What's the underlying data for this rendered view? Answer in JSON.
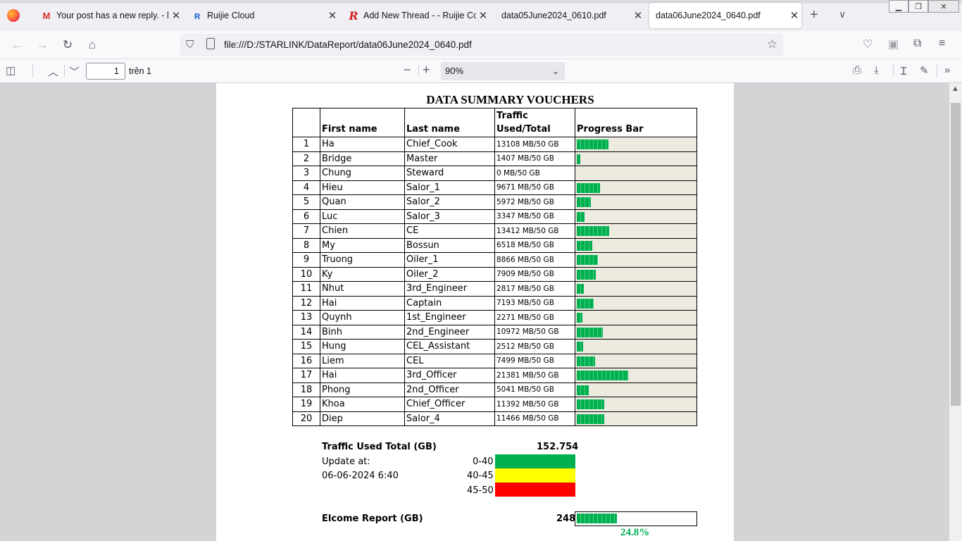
{
  "browser": {
    "tabs": [
      {
        "label": "Your post has a new reply. - lie",
        "icon": "gmail-icon"
      },
      {
        "label": "Ruijie Cloud",
        "icon": "ruijie-icon"
      },
      {
        "label": "Add New Thread - - Ruijie Com",
        "icon": "ruijie-community-icon"
      },
      {
        "label": "data05June2024_0610.pdf",
        "icon": ""
      },
      {
        "label": "data06June2024_0640.pdf",
        "icon": "",
        "active": true
      }
    ],
    "url": "file:///D:/STARLINK/DataReport/data06June2024_0640.pdf"
  },
  "pdf_toolbar": {
    "page_number": "1",
    "page_total": "trên 1",
    "zoom": "90%"
  },
  "report": {
    "title": "DATA SUMMARY VOUCHERS",
    "headers": {
      "num": "",
      "first": "First name",
      "last": "Last name",
      "traffic_line1": "Traffic",
      "traffic_line2": "Used/Total",
      "progress": "Progress Bar"
    },
    "rows": [
      {
        "n": "1",
        "first": "Ha",
        "last": "Chief_Cook",
        "traffic": "13108 MB/50 GB",
        "used_fraction": 0.262
      },
      {
        "n": "2",
        "first": "Bridge",
        "last": "Master",
        "traffic": "1407 MB/50 GB",
        "used_fraction": 0.028
      },
      {
        "n": "3",
        "first": "Chung",
        "last": "Steward",
        "traffic": "0 MB/50 GB",
        "used_fraction": 0.0
      },
      {
        "n": "4",
        "first": "Hieu",
        "last": "Salor_1",
        "traffic": "9671 MB/50 GB",
        "used_fraction": 0.193
      },
      {
        "n": "5",
        "first": "Quan",
        "last": "Salor_2",
        "traffic": "5972 MB/50 GB",
        "used_fraction": 0.119
      },
      {
        "n": "6",
        "first": "Luc",
        "last": "Salor_3",
        "traffic": "3347 MB/50 GB",
        "used_fraction": 0.067
      },
      {
        "n": "7",
        "first": "Chien",
        "last": "CE",
        "traffic": "13412 MB/50 GB",
        "used_fraction": 0.268
      },
      {
        "n": "8",
        "first": "My",
        "last": "Bossun",
        "traffic": "6518 MB/50 GB",
        "used_fraction": 0.13
      },
      {
        "n": "9",
        "first": "Truong",
        "last": "Oiler_1",
        "traffic": "8866 MB/50 GB",
        "used_fraction": 0.177
      },
      {
        "n": "10",
        "first": "Ky",
        "last": "Oiler_2",
        "traffic": "7909 MB/50 GB",
        "used_fraction": 0.158
      },
      {
        "n": "11",
        "first": "Nhut",
        "last": "3rd_Engineer",
        "traffic": "2817 MB/50 GB",
        "used_fraction": 0.056
      },
      {
        "n": "12",
        "first": "Hai",
        "last": "Captain",
        "traffic": "7193 MB/50 GB",
        "used_fraction": 0.144
      },
      {
        "n": "13",
        "first": "Quynh",
        "last": "1st_Engineer",
        "traffic": "2271 MB/50 GB",
        "used_fraction": 0.045
      },
      {
        "n": "14",
        "first": "Binh",
        "last": "2nd_Engineer",
        "traffic": "10972 MB/50 GB",
        "used_fraction": 0.219
      },
      {
        "n": "15",
        "first": "Hung",
        "last": "CEL_Assistant",
        "traffic": "2512 MB/50 GB",
        "used_fraction": 0.05
      },
      {
        "n": "16",
        "first": "Liem",
        "last": "CEL",
        "traffic": "7499 MB/50 GB",
        "used_fraction": 0.15
      },
      {
        "n": "17",
        "first": "Hai",
        "last": "3rd_Officer",
        "traffic": "21381 MB/50 GB",
        "used_fraction": 0.428
      },
      {
        "n": "18",
        "first": "Phong",
        "last": "2nd_Officer",
        "traffic": "5041 MB/50 GB",
        "used_fraction": 0.101
      },
      {
        "n": "19",
        "first": "Khoa",
        "last": "Chief_Officer",
        "traffic": "11392 MB/50 GB",
        "used_fraction": 0.228
      },
      {
        "n": "20",
        "first": "Diep",
        "last": "Salor_4",
        "traffic": "11466 MB/50 GB",
        "used_fraction": 0.229
      }
    ],
    "summary": {
      "traffic_total_label": "Traffic Used Total  (GB)",
      "traffic_total_value": "152.754",
      "update_label": "Update at:",
      "update_time": "06-06-2024 6:40",
      "legend": [
        {
          "range": "0-40",
          "color": "#00b050"
        },
        {
          "range": "40-45",
          "color": "#ffff00"
        },
        {
          "range": "45-50",
          "color": "#ff0000"
        }
      ],
      "elcome_label": "Elcome Report (GB)",
      "elcome_value": "248",
      "elcome_fraction": 0.248,
      "elcome_percent": "24.8%"
    }
  }
}
